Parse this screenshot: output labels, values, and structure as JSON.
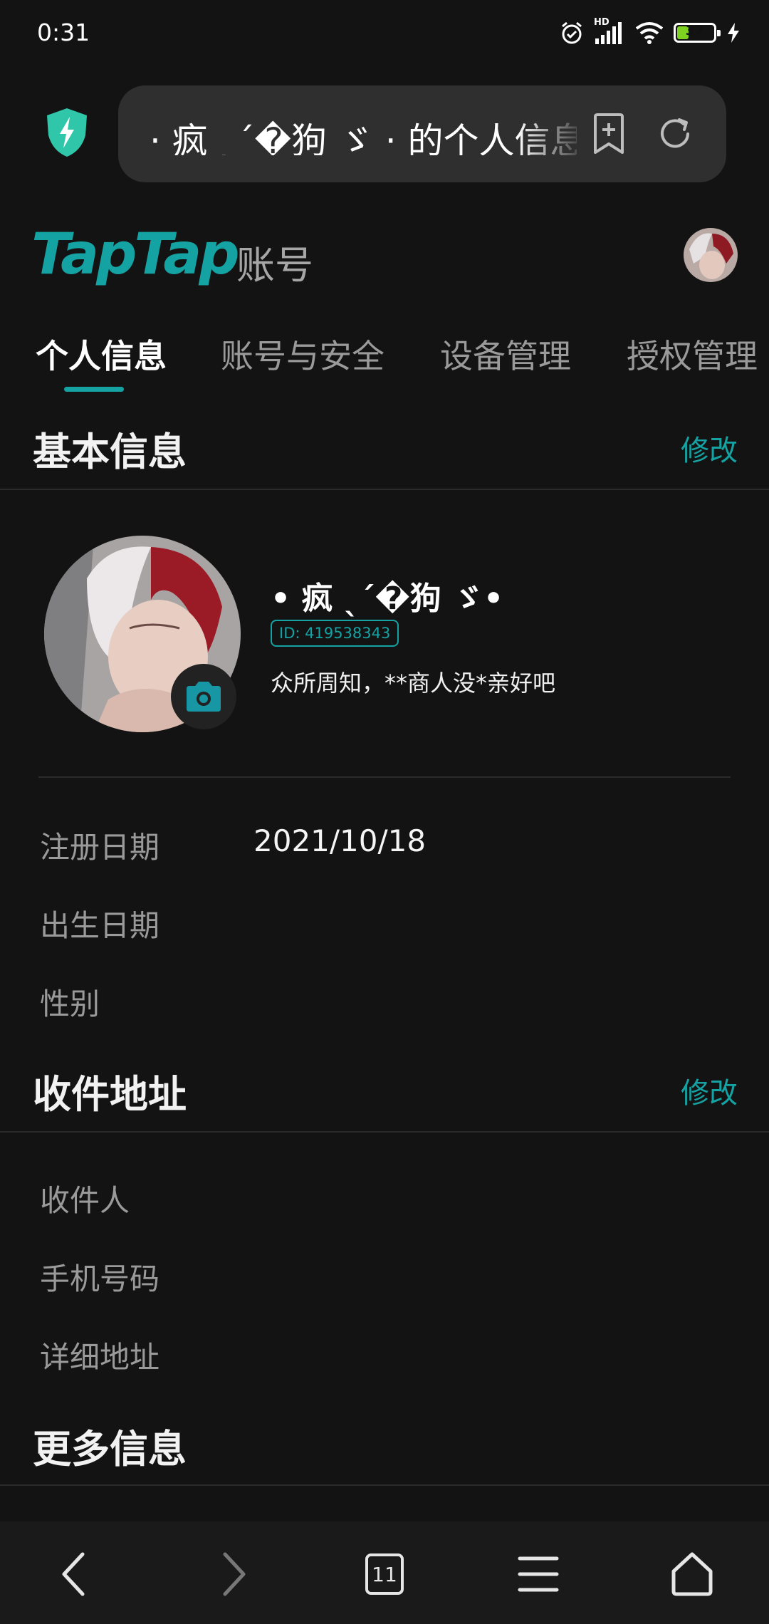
{
  "status_bar": {
    "time": "0:31",
    "battery": "37",
    "network_label": "HD"
  },
  "address_bar": {
    "url_text": "· 疯 ˎˊ�狗 ゞ · 的个人信息"
  },
  "header": {
    "logo": "TapTap",
    "subtitle": "账号"
  },
  "tabs": [
    {
      "label": "个人信息",
      "active": true
    },
    {
      "label": "账号与安全",
      "active": false
    },
    {
      "label": "设备管理",
      "active": false
    },
    {
      "label": "授权管理",
      "active": false
    }
  ],
  "basic_info": {
    "title": "基本信息",
    "edit_label": "修改",
    "nickname": "• 疯 ˎˊ�狗 ゞ•",
    "id_label": "ID: 419538343",
    "bio": "众所周知，**商人没*亲好吧",
    "fields": [
      {
        "label": "注册日期",
        "value": "2021/10/18"
      },
      {
        "label": "出生日期",
        "value": ""
      },
      {
        "label": "性别",
        "value": ""
      }
    ]
  },
  "address": {
    "title": "收件地址",
    "edit_label": "修改",
    "fields": [
      {
        "label": "收件人",
        "value": ""
      },
      {
        "label": "手机号码",
        "value": ""
      },
      {
        "label": "详细地址",
        "value": ""
      }
    ]
  },
  "more_info": {
    "title": "更多信息"
  },
  "bottom_nav": {
    "tab_count": "11"
  },
  "colors": {
    "accent": "#15a2a3",
    "background": "#131313",
    "urlbar": "#2f2f2f"
  },
  "icons": [
    "alarm-icon",
    "signal-icon",
    "wifi-icon",
    "battery-icon",
    "charging-icon",
    "shield-icon",
    "bookmark-add-icon",
    "reload-icon",
    "camera-icon",
    "back-icon",
    "forward-icon",
    "tabs-icon",
    "menu-icon",
    "home-icon"
  ]
}
